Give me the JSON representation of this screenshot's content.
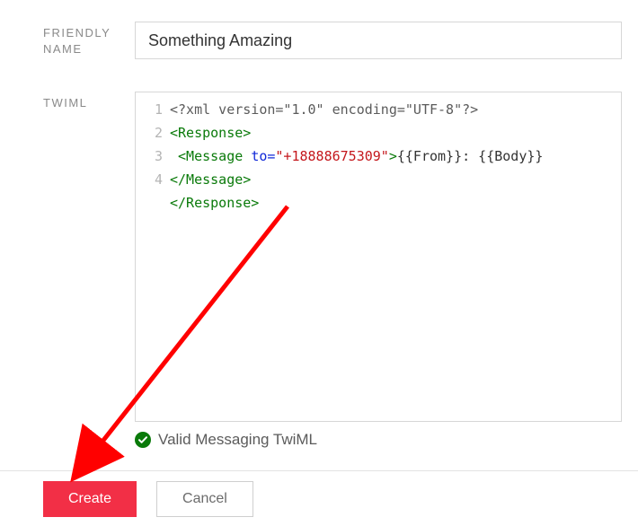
{
  "labels": {
    "friendly_name": "FRIENDLY NAME",
    "twiml": "TWIML"
  },
  "friendly_name_value": "Something Amazing",
  "editor": {
    "gutter": [
      "1",
      "2",
      "3",
      "4"
    ],
    "line1": "<?xml version=\"1.0\" encoding=\"UTF-8\"?>",
    "line2_open": "<Response>",
    "line3_msg_open": " <Message ",
    "line3_attr": "to",
    "line3_eq": "=",
    "line3_val": "\"+18888675309\"",
    "line3_close": ">",
    "line3_text": "{{From}}: {{Body}}",
    "line3_end": "</Message>",
    "line4_close": "</Response>"
  },
  "validation": {
    "text": "Valid Messaging TwiML"
  },
  "buttons": {
    "create": "Create",
    "cancel": "Cancel"
  }
}
